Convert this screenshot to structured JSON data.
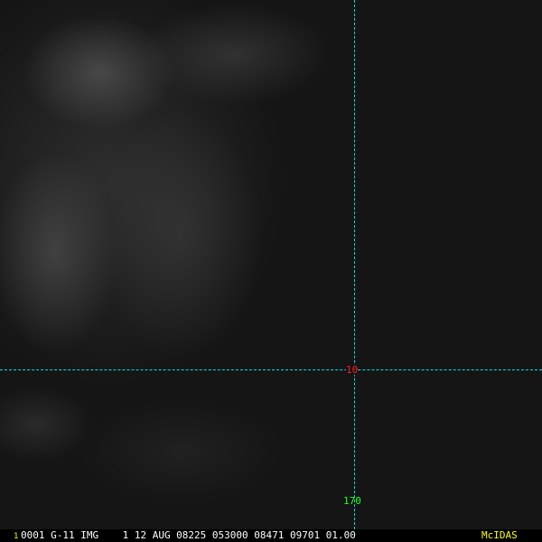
{
  "frame_number": "1",
  "header_line": "0001 G-11 IMG    1 12 AUG 08225 053000 08471 09701 01.00",
  "brand": "McIDAS",
  "grid_labels": {
    "latitude": "10",
    "longitude": "170"
  },
  "colors": {
    "grid": "#00e0e0",
    "lat_label": "#ff2020",
    "lon_label": "#20ff20",
    "brand": "#ffff00"
  }
}
